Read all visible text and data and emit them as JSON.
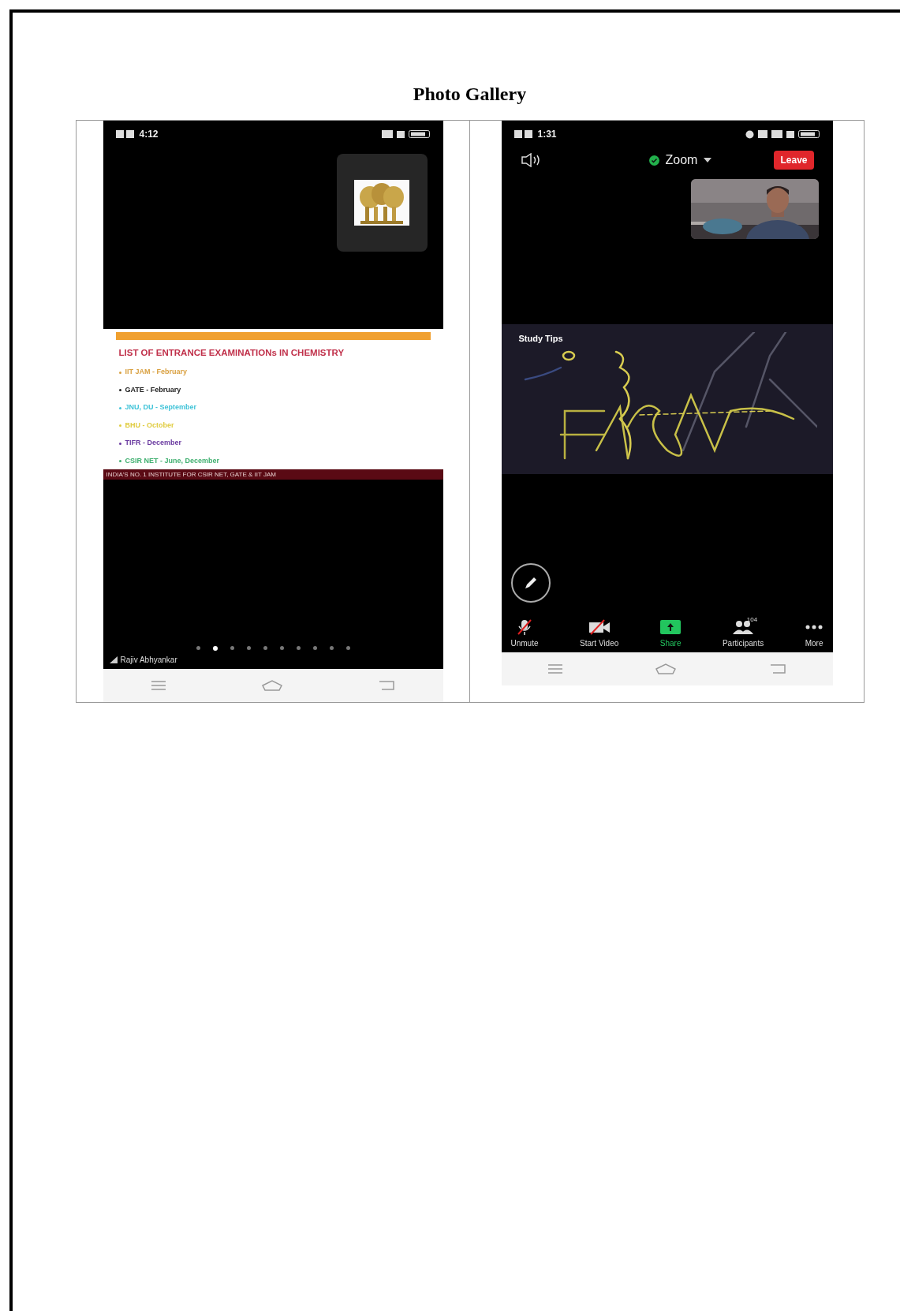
{
  "title": "Photo Gallery",
  "left_phone": {
    "status_time": "4:12",
    "slide": {
      "title": "LIST OF ENTRANCE EXAMINATIONs IN CHEMISTRY",
      "items": [
        {
          "text": "IIT JAM - February",
          "color": "#d9a040"
        },
        {
          "text": "GATE - February",
          "color": "#222222"
        },
        {
          "text": "JNU, DU - September",
          "color": "#3fc3d8"
        },
        {
          "text": "BHU - October",
          "color": "#e0cc40"
        },
        {
          "text": "TIFR - December",
          "color": "#6a3aa0"
        },
        {
          "text": "CSIR NET - June, December",
          "color": "#40b070"
        }
      ],
      "banner": "INDIA'S NO. 1 INSTITUTE FOR CSIR NET, GATE & IIT JAM"
    },
    "speaker_name": "Rajiv Abhyankar",
    "page_dots": [
      {
        "selected": false
      },
      {
        "selected": true
      },
      {
        "selected": false
      },
      {
        "selected": false
      },
      {
        "selected": false
      },
      {
        "selected": false
      },
      {
        "selected": false
      },
      {
        "selected": false
      },
      {
        "selected": false
      },
      {
        "selected": false
      }
    ]
  },
  "right_phone": {
    "status_time": "1:31",
    "meeting_title": "Zoom",
    "leave_button": "Leave",
    "share_label": "Study Tips",
    "toolbar": [
      {
        "kind": "mic",
        "label": "Unmute"
      },
      {
        "kind": "video",
        "label": "Start Video"
      },
      {
        "kind": "share",
        "label": "Share"
      },
      {
        "kind": "participants",
        "label": "Participants",
        "badge": "104"
      },
      {
        "kind": "more",
        "label": "More"
      }
    ]
  }
}
